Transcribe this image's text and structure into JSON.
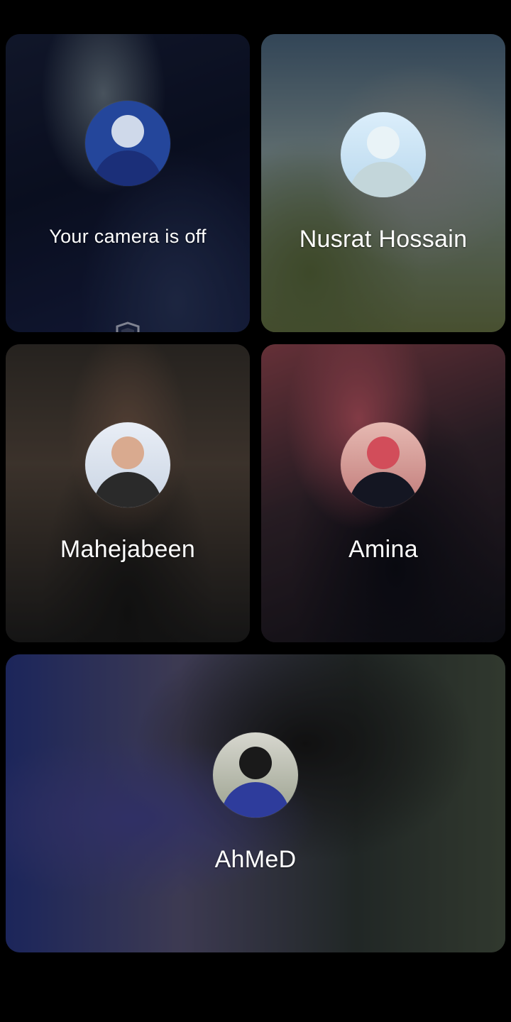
{
  "tiles": [
    {
      "id": "self",
      "label": "Your camera is off",
      "avatar": "user-avatar",
      "icon": "shield-icon"
    },
    {
      "id": "nusrat",
      "label": "Nusrat Hossain",
      "avatar": "user-avatar"
    },
    {
      "id": "mahe",
      "label": "Mahejabeen",
      "avatar": "user-avatar"
    },
    {
      "id": "amina",
      "label": "Amina",
      "avatar": "user-avatar"
    },
    {
      "id": "ahmed",
      "label": "AhMeD",
      "avatar": "user-avatar"
    }
  ],
  "colors": {
    "background": "#000000",
    "text": "#ffffff"
  }
}
